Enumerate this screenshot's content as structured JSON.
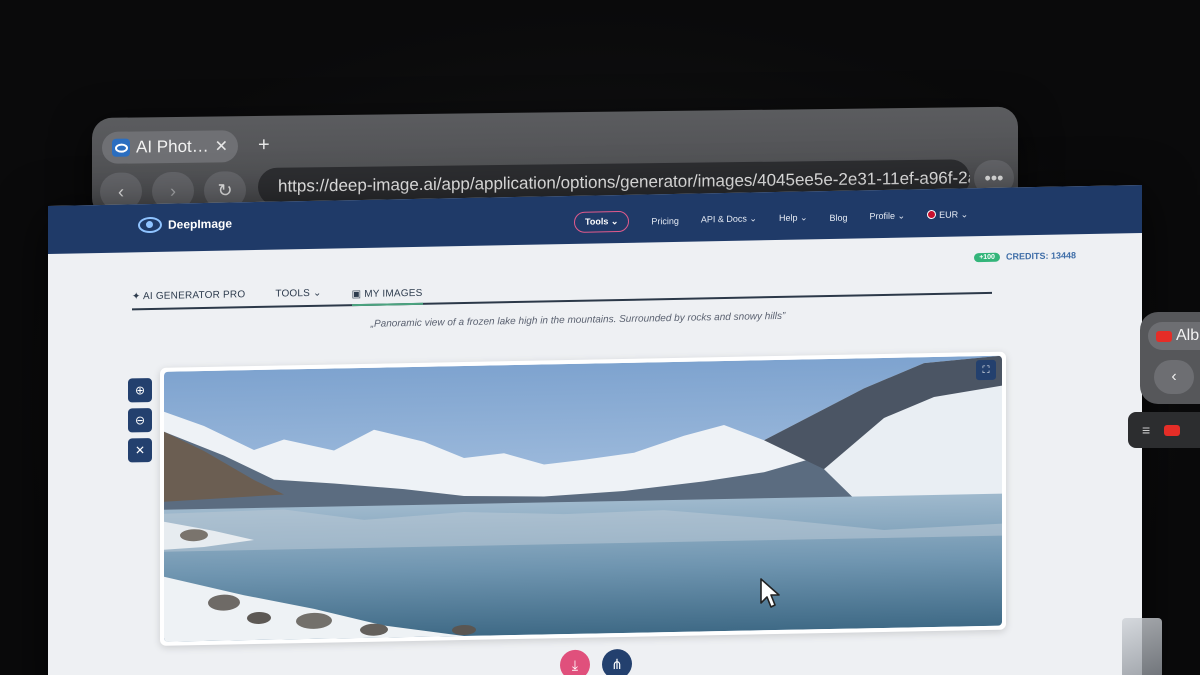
{
  "browser": {
    "tab_title": "AI Phot…",
    "tab_close": "✕",
    "new_tab": "+",
    "back": "‹",
    "forward": "›",
    "reload": "↻",
    "url": "https://deep-image.ai/app/application/options/generator/images/4045ee5e-2e31-11ef-a96f-2a",
    "more": "•••"
  },
  "site": {
    "logo_text": "DeepImage",
    "nav": {
      "tools": "Tools ⌄",
      "pricing": "Pricing",
      "api_docs": "API & Docs ⌄",
      "help": "Help ⌄",
      "blog": "Blog",
      "profile": "Profile ⌄",
      "currency": "EUR ⌄"
    },
    "credits_badge": "+100",
    "credits": "CREDITS: 13448",
    "subnav": {
      "ai_generator": "✦ AI GENERATOR PRO",
      "tools": "TOOLS ⌄",
      "my_images": "▣ MY IMAGES"
    },
    "prompt": "„Panoramic view of a frozen lake high in the mountains. Surrounded by rocks and snowy hills”",
    "zoom_in": "⊕",
    "zoom_out": "⊖",
    "close": "✕",
    "fullscreen": "⛶",
    "download": "⤓",
    "share": "⋔"
  },
  "side": {
    "tab_label": "Alb",
    "back": "‹",
    "menu": "≡"
  },
  "colors": {
    "topbar": "#1f3a68",
    "accent_pink": "#e0507c",
    "credits_green": "#33b57a"
  }
}
